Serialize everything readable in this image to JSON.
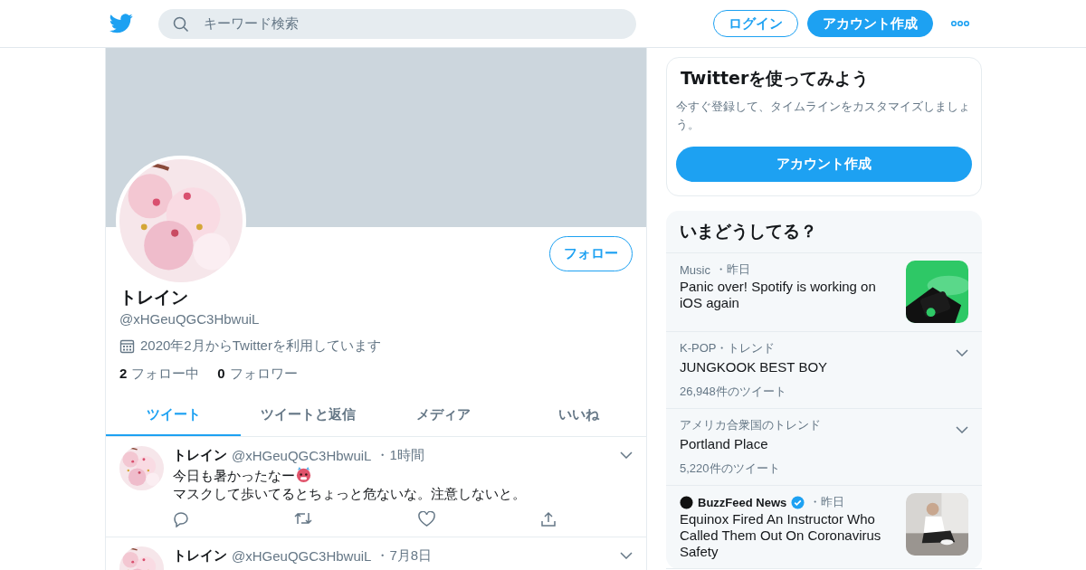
{
  "header": {
    "search": {
      "placeholder": "キーワード検索"
    },
    "login": "ログイン",
    "signup": "アカウント作成"
  },
  "profile": {
    "follow_button": "フォロー",
    "name": "トレイン",
    "handle": "@xHGeuQGC3HbwuiL",
    "joined": "2020年2月からTwitterを利用しています",
    "stats": [
      {
        "count": "2",
        "label": "フォロー中"
      },
      {
        "count": "0",
        "label": "フォロワー"
      }
    ]
  },
  "tabs": [
    {
      "label": "ツイート",
      "selected": true
    },
    {
      "label": "ツイートと返信",
      "selected": false
    },
    {
      "label": "メディア",
      "selected": false
    },
    {
      "label": "いいね",
      "selected": false
    }
  ],
  "tweets": [
    {
      "name": "トレイン",
      "handle": "@xHGeuQGC3HbwuiL",
      "time": "・1時間",
      "lines": [
        "今日も暑かったなー",
        "マスクして歩いてるとちょっと危ないな。注意しないと。"
      ],
      "emoji": true
    },
    {
      "name": "トレイン",
      "handle": "@xHGeuQGC3HbwuiL",
      "time": "・7月8日"
    }
  ],
  "signup_card": {
    "title": "Twitterを使ってみよう",
    "text": "今すぐ登録して、タイムラインをカスタマイズしましょう。",
    "button": "アカウント作成"
  },
  "trends": {
    "title": "いまどうしてる？",
    "items": [
      {
        "kind": "story",
        "category": "Music",
        "time": "・昨日",
        "headline": "Panic over! Spotify is working on iOS again"
      },
      {
        "kind": "trend",
        "category": "K-POP・トレンド",
        "name": "JUNGKOOK BEST BOY",
        "count": "26,948件のツイート"
      },
      {
        "kind": "trend",
        "category": "アメリカ合衆国のトレンド",
        "name": "Portland Place",
        "count": "5,220件のツイート"
      },
      {
        "kind": "news",
        "source": "BuzzFeed News",
        "verified": true,
        "time": "・昨日",
        "headline": "Equinox Fired An Instructor Who Called Them Out On Coronavirus Safety"
      }
    ]
  }
}
